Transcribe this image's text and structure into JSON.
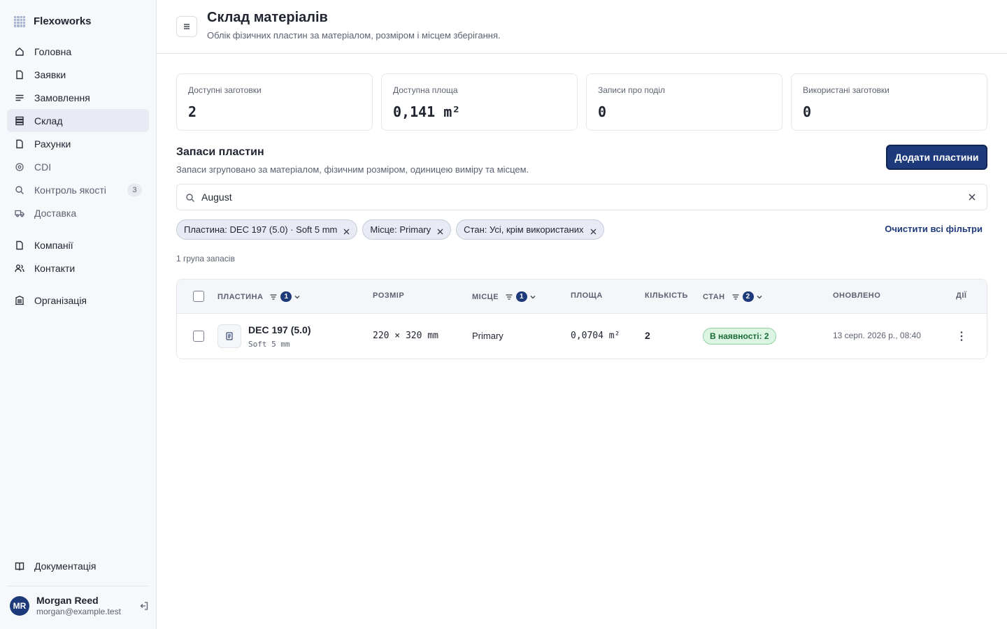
{
  "brand": {
    "name": "Flexoworks"
  },
  "sidebar": {
    "items": [
      {
        "label": "Головна",
        "icon": "home-icon"
      },
      {
        "label": "Заявки",
        "icon": "document-icon"
      },
      {
        "label": "Замовлення",
        "icon": "list-icon"
      },
      {
        "label": "Склад",
        "icon": "stack-icon",
        "active": true
      },
      {
        "label": "Рахунки",
        "icon": "invoice-icon"
      },
      {
        "label": "CDI",
        "icon": "target-icon"
      },
      {
        "label": "Контроль якості",
        "icon": "search-icon",
        "badge": "3"
      },
      {
        "label": "Доставка",
        "icon": "truck-icon"
      },
      {
        "label": "Компанії",
        "icon": "company-icon"
      },
      {
        "label": "Контакти",
        "icon": "contacts-icon"
      },
      {
        "label": "Організація",
        "icon": "building-icon"
      }
    ],
    "docs_label": "Документація",
    "user": {
      "initials": "MR",
      "name": "Morgan Reed",
      "email": "morgan@example.test"
    }
  },
  "header": {
    "title": "Склад матеріалів",
    "subtitle": "Облік фізичних пластин за матеріалом, розміром і місцем зберігання."
  },
  "stats": [
    {
      "label": "Доступні заготовки",
      "value": "2"
    },
    {
      "label": "Доступна площа",
      "value": "0,141 m²"
    },
    {
      "label": "Записи про поділ",
      "value": "0"
    },
    {
      "label": "Використані заготовки",
      "value": "0"
    }
  ],
  "section": {
    "title": "Запаси пластин",
    "subtitle": "Запаси згруповано за матеріалом, фізичним розміром, одиницею виміру та місцем.",
    "add_button": "Додати пластини"
  },
  "search": {
    "value": "August",
    "placeholder": ""
  },
  "chips": [
    {
      "label": "Пластина: DEC 197 (5.0) · Soft 5 mm"
    },
    {
      "label": "Місце: Primary"
    },
    {
      "label": "Стан: Усі, крім використаних"
    }
  ],
  "clear_all": "Очистити всі фільтри",
  "group_count": "1 група запасів",
  "table": {
    "headers": {
      "plate": "ПЛАСТИНА",
      "plate_filter": "1",
      "size": "РОЗМІР",
      "location": "МІСЦЕ",
      "location_filter": "1",
      "area": "ПЛОЩА",
      "quantity": "КІЛЬКІСТЬ",
      "status": "СТАН",
      "status_filter": "2",
      "updated": "ОНОВЛЕНО",
      "actions": "ДІЇ"
    },
    "rows": [
      {
        "plate": "DEC 197 (5.0)",
        "plate_sub": "Soft 5 mm",
        "size": "220 × 320 mm",
        "location": "Primary",
        "area": "0,0704 m²",
        "quantity": "2",
        "status": "В наявності: 2",
        "updated": "13 серп. 2026 р., 08:40"
      }
    ]
  },
  "colors": {
    "accent": "#1f3a7a",
    "status_bg": "#dcf5e3",
    "status_text": "#1a6b35"
  }
}
